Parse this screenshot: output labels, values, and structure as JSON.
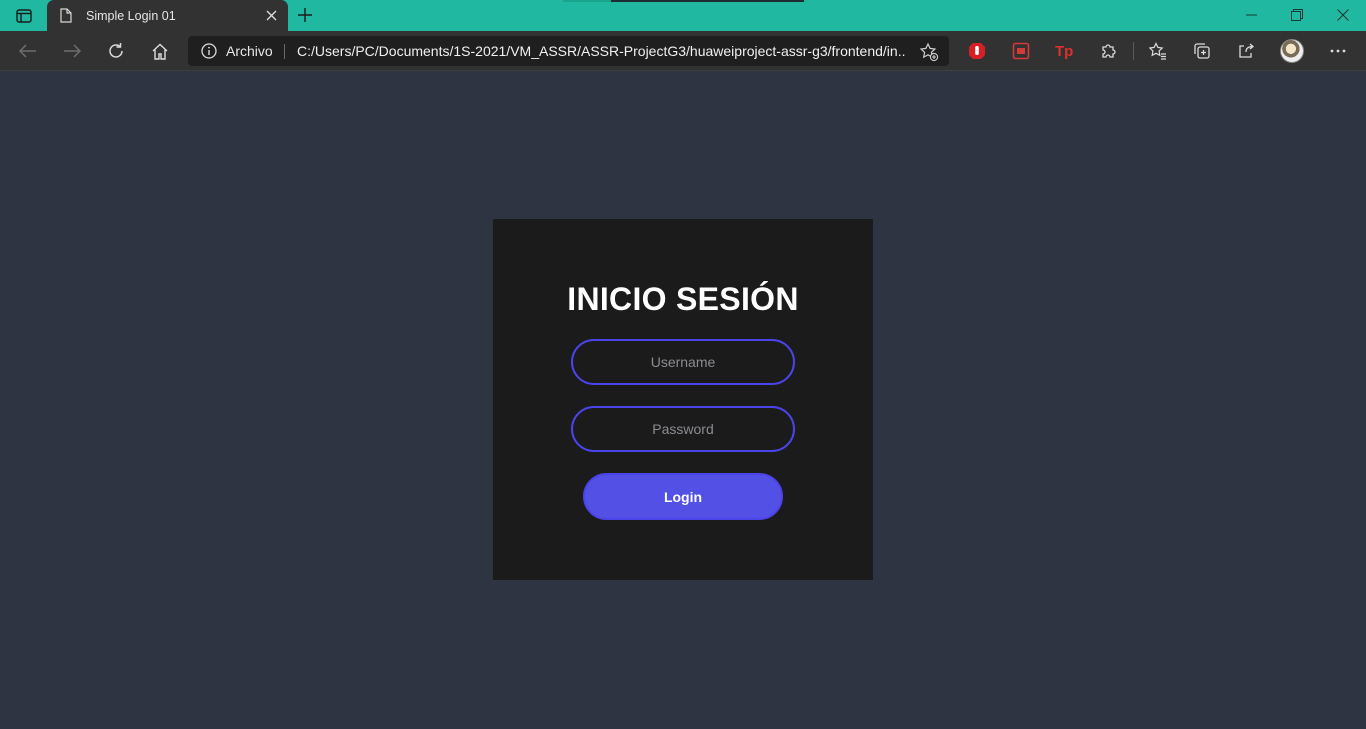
{
  "window": {
    "tab_title": "Simple Login 01",
    "new_tab_symbol": "+"
  },
  "toolbar": {
    "address_scheme": "Archivo",
    "address_url": "C:/Users/PC/Documents/1S-2021/VM_ASSR/ASSR-ProjectG3/huaweiproject-assr-g3/frontend/in...",
    "extensions": [
      "hand-stop-icon",
      "recorder-icon",
      "tp-icon",
      "puzzle-icon"
    ]
  },
  "login": {
    "title": "INICIO SESIÓN",
    "username_placeholder": "Username",
    "password_placeholder": "Password",
    "button_label": "Login"
  },
  "colors": {
    "titlebar": "#20b8a1",
    "page_bg": "#2f3443",
    "card_bg": "#1b1b1c",
    "accent": "#4b44ea",
    "button": "#5350e6"
  }
}
